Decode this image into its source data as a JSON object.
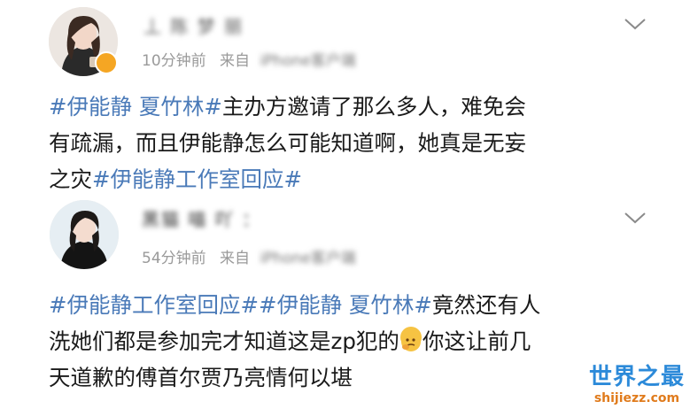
{
  "posts": [
    {
      "username": "丄 陈 梦 丽",
      "time": "10分钟前",
      "source_prefix": "来自",
      "source_blurred": "iPhone客户端",
      "content_lines": [
        [
          {
            "t": "#伊能静 夏竹林#",
            "tag": true
          },
          {
            "t": "主办方邀请了那么多人，难免会",
            "tag": false
          }
        ],
        [
          {
            "t": "有疏漏，而且伊能静怎么可能知道啊，她真是无妄",
            "tag": false
          }
        ],
        [
          {
            "t": "之灾",
            "tag": false
          },
          {
            "t": "#伊能静工作室回应#",
            "tag": true
          }
        ]
      ]
    },
    {
      "username": "黑猫 喵 吖 ：",
      "time": "54分钟前",
      "source_prefix": "来自",
      "source_blurred": "iPhone客户端",
      "content_lines": [
        [
          {
            "t": "#伊能静工作室回应##伊能静 夏竹林#",
            "tag": true
          },
          {
            "t": "竟然还有人",
            "tag": false
          }
        ],
        [
          {
            "t": "洗她们都是参加完才知道这是zp犯的",
            "tag": false
          },
          {
            "emoji": "thinking-emoji"
          },
          {
            "t": "你这让前几",
            "tag": false
          }
        ],
        [
          {
            "t": "天道歉的傅首尔贾乃亮情何以堪",
            "tag": false
          }
        ]
      ]
    }
  ],
  "watermark": {
    "main": "世界之最",
    "sub": "shijiezz.com"
  },
  "colors": {
    "tag": "#4a7ab8",
    "meta": "#9a9a9a",
    "verified": "#f5a623"
  }
}
